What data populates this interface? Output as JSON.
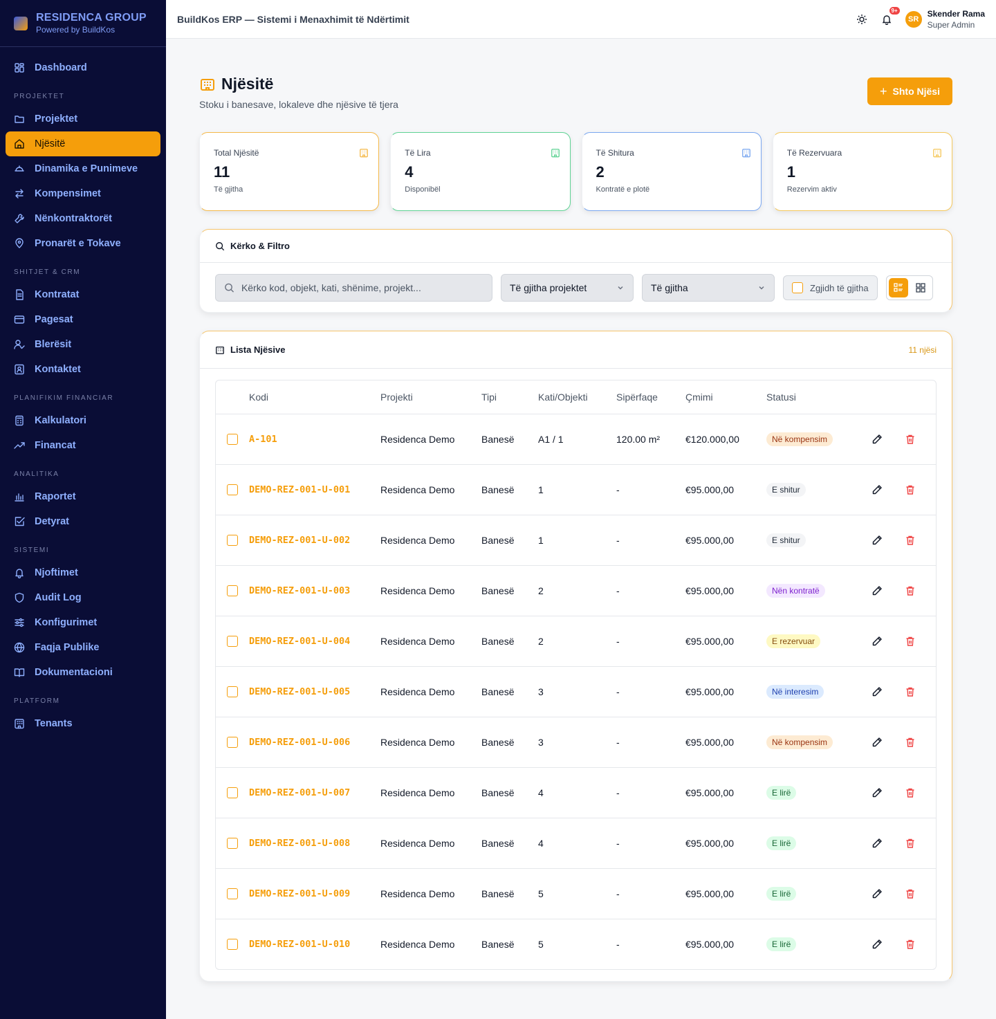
{
  "brand": {
    "name": "RESIDENCA GROUP",
    "sub": "Powered by BuildKos"
  },
  "sidebar": {
    "dashboard": "Dashboard",
    "sections": [
      {
        "title": "PROJEKTET",
        "items": [
          {
            "label": "Projektet",
            "icon": "folder-icon"
          },
          {
            "label": "Njësitë",
            "icon": "home-icon",
            "active": true
          },
          {
            "label": "Dinamika e Punimeve",
            "icon": "helmet-icon"
          },
          {
            "label": "Kompensimet",
            "icon": "swap-icon"
          },
          {
            "label": "Nënkontraktorët",
            "icon": "wrench-icon"
          },
          {
            "label": "Pronarët e Tokave",
            "icon": "map-pin-icon"
          }
        ]
      },
      {
        "title": "SHITJET & CRM",
        "items": [
          {
            "label": "Kontratat",
            "icon": "file-icon"
          },
          {
            "label": "Pagesat",
            "icon": "card-icon"
          },
          {
            "label": "Blerësit",
            "icon": "user-check-icon"
          },
          {
            "label": "Kontaktet",
            "icon": "contact-icon"
          }
        ]
      },
      {
        "title": "PLANIFIKIM FINANCIAR",
        "items": [
          {
            "label": "Kalkulatori",
            "icon": "calculator-icon"
          },
          {
            "label": "Financat",
            "icon": "trend-icon"
          }
        ]
      },
      {
        "title": "ANALITIKA",
        "items": [
          {
            "label": "Raportet",
            "icon": "bar-chart-icon"
          },
          {
            "label": "Detyrat",
            "icon": "check-square-icon"
          }
        ]
      },
      {
        "title": "SISTEMI",
        "items": [
          {
            "label": "Njoftimet",
            "icon": "bell-icon"
          },
          {
            "label": "Audit Log",
            "icon": "shield-icon"
          },
          {
            "label": "Konfigurimet",
            "icon": "sliders-icon"
          },
          {
            "label": "Faqja Publike",
            "icon": "globe-icon"
          },
          {
            "label": "Dokumentacioni",
            "icon": "book-icon"
          }
        ]
      },
      {
        "title": "PLATFORM",
        "items": [
          {
            "label": "Tenants",
            "icon": "building-icon"
          }
        ]
      }
    ]
  },
  "topbar": {
    "title": "BuildKos ERP — Sistemi i Menaxhimit të Ndërtimit",
    "badge": "9+",
    "user_name": "Skender Rama",
    "user_role": "Super Admin",
    "initials": "SR"
  },
  "page": {
    "title": "Njësitë",
    "subtitle": "Stoku i banesave, lokaleve dhe njësive të tjera",
    "add_button": "Shto Njësi"
  },
  "stats": [
    {
      "label": "Total Njësitë",
      "value": "11",
      "sub": "Të gjitha",
      "color": "#f5b94a"
    },
    {
      "label": "Të Lira",
      "value": "4",
      "sub": "Disponibël",
      "color": "#5fd394"
    },
    {
      "label": "Të Shitura",
      "value": "2",
      "sub": "Kontratë e plotë",
      "color": "#7aa7f0"
    },
    {
      "label": "Të Rezervuara",
      "value": "1",
      "sub": "Rezervim aktiv",
      "color": "#f5c85c"
    }
  ],
  "filter": {
    "title": "Kërko & Filtro",
    "search_placeholder": "Kërko kod, objekt, kati, shënime, projekt...",
    "project_select": "Të gjitha projektet",
    "status_select": "Të gjitha",
    "select_all": "Zgjidh të gjitha"
  },
  "list": {
    "title": "Lista Njësive",
    "count": "11 njësi",
    "columns": [
      "Kodi",
      "Projekti",
      "Tipi",
      "Kati/Objekti",
      "Sipërfaqe",
      "Çmimi",
      "Statusi"
    ],
    "rows": [
      {
        "code": "A-101",
        "project": "Residenca Demo",
        "type": "Banesë",
        "floor": "A1 / 1",
        "area": "120.00 m²",
        "price": "€120.000,00",
        "status": "Në kompensim",
        "status_bg": "#fdebd3",
        "status_fg": "#9a3412"
      },
      {
        "code": "DEMO-REZ-001-U-001",
        "project": "Residenca Demo",
        "type": "Banesë",
        "floor": "1",
        "area": "-",
        "price": "€95.000,00",
        "status": "E shitur",
        "status_bg": "#f3f4f6",
        "status_fg": "#1f2937"
      },
      {
        "code": "DEMO-REZ-001-U-002",
        "project": "Residenca Demo",
        "type": "Banesë",
        "floor": "1",
        "area": "-",
        "price": "€95.000,00",
        "status": "E shitur",
        "status_bg": "#f3f4f6",
        "status_fg": "#1f2937"
      },
      {
        "code": "DEMO-REZ-001-U-003",
        "project": "Residenca Demo",
        "type": "Banesë",
        "floor": "2",
        "area": "-",
        "price": "€95.000,00",
        "status": "Nën kontratë",
        "status_bg": "#f3e8ff",
        "status_fg": "#7e22ce"
      },
      {
        "code": "DEMO-REZ-001-U-004",
        "project": "Residenca Demo",
        "type": "Banesë",
        "floor": "2",
        "area": "-",
        "price": "€95.000,00",
        "status": "E rezervuar",
        "status_bg": "#fef9c3",
        "status_fg": "#854d0e"
      },
      {
        "code": "DEMO-REZ-001-U-005",
        "project": "Residenca Demo",
        "type": "Banesë",
        "floor": "3",
        "area": "-",
        "price": "€95.000,00",
        "status": "Në interesim",
        "status_bg": "#dbeafe",
        "status_fg": "#1e40af"
      },
      {
        "code": "DEMO-REZ-001-U-006",
        "project": "Residenca Demo",
        "type": "Banesë",
        "floor": "3",
        "area": "-",
        "price": "€95.000,00",
        "status": "Në kompensim",
        "status_bg": "#fdebd3",
        "status_fg": "#9a3412"
      },
      {
        "code": "DEMO-REZ-001-U-007",
        "project": "Residenca Demo",
        "type": "Banesë",
        "floor": "4",
        "area": "-",
        "price": "€95.000,00",
        "status": "E lirë",
        "status_bg": "#dcfce7",
        "status_fg": "#166534"
      },
      {
        "code": "DEMO-REZ-001-U-008",
        "project": "Residenca Demo",
        "type": "Banesë",
        "floor": "4",
        "area": "-",
        "price": "€95.000,00",
        "status": "E lirë",
        "status_bg": "#dcfce7",
        "status_fg": "#166534"
      },
      {
        "code": "DEMO-REZ-001-U-009",
        "project": "Residenca Demo",
        "type": "Banesë",
        "floor": "5",
        "area": "-",
        "price": "€95.000,00",
        "status": "E lirë",
        "status_bg": "#dcfce7",
        "status_fg": "#166534"
      },
      {
        "code": "DEMO-REZ-001-U-010",
        "project": "Residenca Demo",
        "type": "Banesë",
        "floor": "5",
        "area": "-",
        "price": "€95.000,00",
        "status": "E lirë",
        "status_bg": "#dcfce7",
        "status_fg": "#166534"
      }
    ]
  },
  "colors": {
    "accent": "#f59e0b",
    "sidebar_bg": "#0a0d36",
    "danger": "#ef4444"
  }
}
